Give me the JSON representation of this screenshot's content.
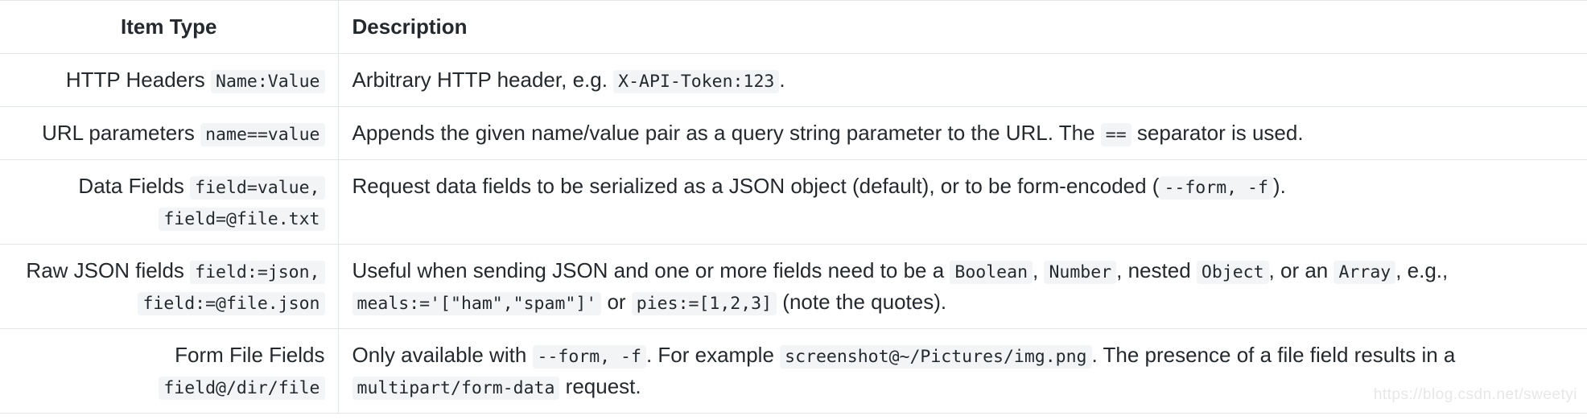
{
  "table": {
    "columns": [
      {
        "key": "item_type",
        "label": "Item Type",
        "align": "center"
      },
      {
        "key": "description",
        "label": "Description",
        "align": "left"
      }
    ],
    "rows": [
      {
        "type_label": "HTTP Headers",
        "type_code": "Name:Value",
        "type_code_2": "",
        "desc_parts": [
          {
            "kind": "text",
            "text": "Arbitrary HTTP header, e.g. "
          },
          {
            "kind": "code",
            "text": "X-API-Token:123"
          },
          {
            "kind": "text",
            "text": "."
          }
        ]
      },
      {
        "type_label": "URL parameters",
        "type_code": "name==value",
        "type_code_2": "",
        "desc_parts": [
          {
            "kind": "text",
            "text": "Appends the given name/value pair as a query string parameter to the URL. The "
          },
          {
            "kind": "code",
            "text": "=="
          },
          {
            "kind": "text",
            "text": " separator is used."
          }
        ]
      },
      {
        "type_label": "Data Fields",
        "type_code": "field=value,",
        "type_code_2": "field=@file.txt",
        "desc_parts": [
          {
            "kind": "text",
            "text": "Request data fields to be serialized as a JSON object (default), or to be form-encoded ("
          },
          {
            "kind": "code",
            "text": "--form, -f"
          },
          {
            "kind": "text",
            "text": ")."
          }
        ]
      },
      {
        "type_label": "Raw JSON fields",
        "type_code": "field:=json,",
        "type_code_2": "field:=@file.json",
        "desc_parts": [
          {
            "kind": "text",
            "text": "Useful when sending JSON and one or more fields need to be a "
          },
          {
            "kind": "code",
            "text": "Boolean"
          },
          {
            "kind": "text",
            "text": ", "
          },
          {
            "kind": "code",
            "text": "Number"
          },
          {
            "kind": "text",
            "text": ", nested "
          },
          {
            "kind": "code",
            "text": "Object"
          },
          {
            "kind": "text",
            "text": ", or an "
          },
          {
            "kind": "code",
            "text": "Array"
          },
          {
            "kind": "text",
            "text": ", e.g., "
          },
          {
            "kind": "code",
            "text": "meals:='[\"ham\",\"spam\"]'"
          },
          {
            "kind": "text",
            "text": " or "
          },
          {
            "kind": "code",
            "text": "pies:=[1,2,3]"
          },
          {
            "kind": "text",
            "text": " (note the quotes)."
          }
        ]
      },
      {
        "type_label": "Form File Fields",
        "type_code": "field@/dir/file",
        "type_code_2": "",
        "desc_parts": [
          {
            "kind": "text",
            "text": "Only available with "
          },
          {
            "kind": "code",
            "text": "--form, -f"
          },
          {
            "kind": "text",
            "text": ". For example "
          },
          {
            "kind": "code",
            "text": "screenshot@~/Pictures/img.png"
          },
          {
            "kind": "text",
            "text": ". The presence of a file field results in a "
          },
          {
            "kind": "code",
            "text": "multipart/form-data"
          },
          {
            "kind": "text",
            "text": " request."
          }
        ]
      }
    ]
  },
  "watermark": {
    "text": "https://blog.csdn.net/sweetyi"
  },
  "colors": {
    "border": "#e1e4e8",
    "code_background": "#f3f4f6",
    "text": "#24292e",
    "watermark": "#e7e7e7"
  }
}
